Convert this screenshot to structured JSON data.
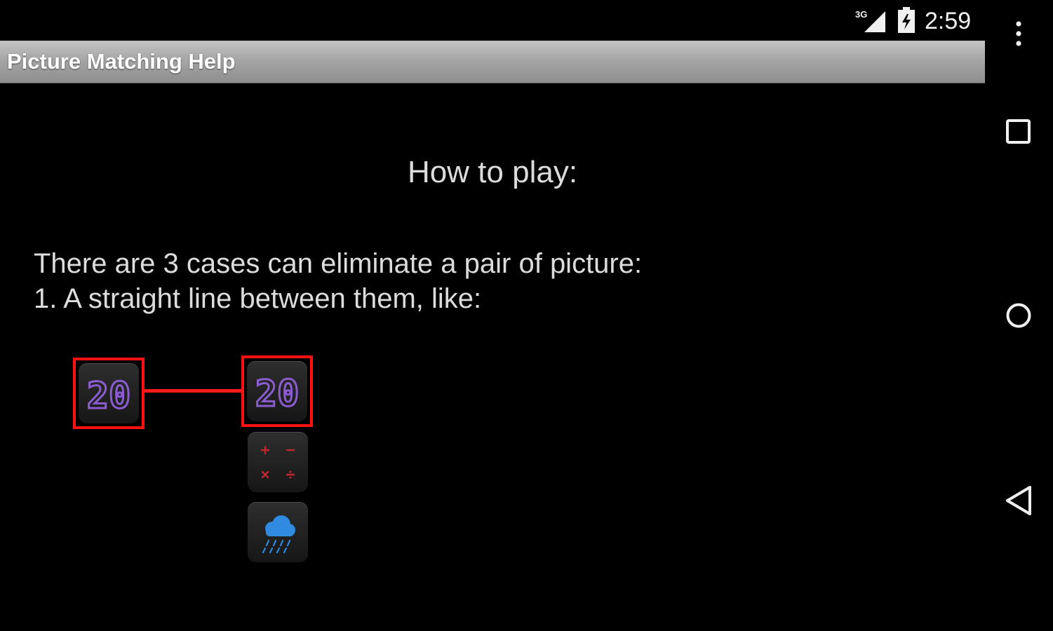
{
  "status_bar": {
    "network": "3G",
    "time": "2:59",
    "icons": [
      "signal-icon",
      "battery-icon"
    ]
  },
  "title_bar": {
    "title": "Picture Matching Help"
  },
  "nav_bar": {
    "icons": [
      "overflow-menu-icon",
      "recents-icon",
      "home-icon",
      "back-icon"
    ]
  },
  "content": {
    "heading": "How to play:",
    "lines": [
      "There are 3 cases can eliminate a pair of picture:",
      "1. A straight line between them, like:"
    ]
  },
  "example": {
    "tiles": [
      {
        "icon": "calendar-20-icon",
        "text": "20",
        "selected": true
      },
      {
        "icon": "calendar-20-icon",
        "text": "20",
        "selected": true
      },
      {
        "icon": "calculator-icon",
        "selected": false
      },
      {
        "icon": "rain-cloud-icon",
        "selected": false
      }
    ],
    "colors": {
      "selection": "#ff1111",
      "digits": "#8a5cd0",
      "calc_symbols": "#c0272d",
      "rain": "#2f8ae0"
    }
  }
}
